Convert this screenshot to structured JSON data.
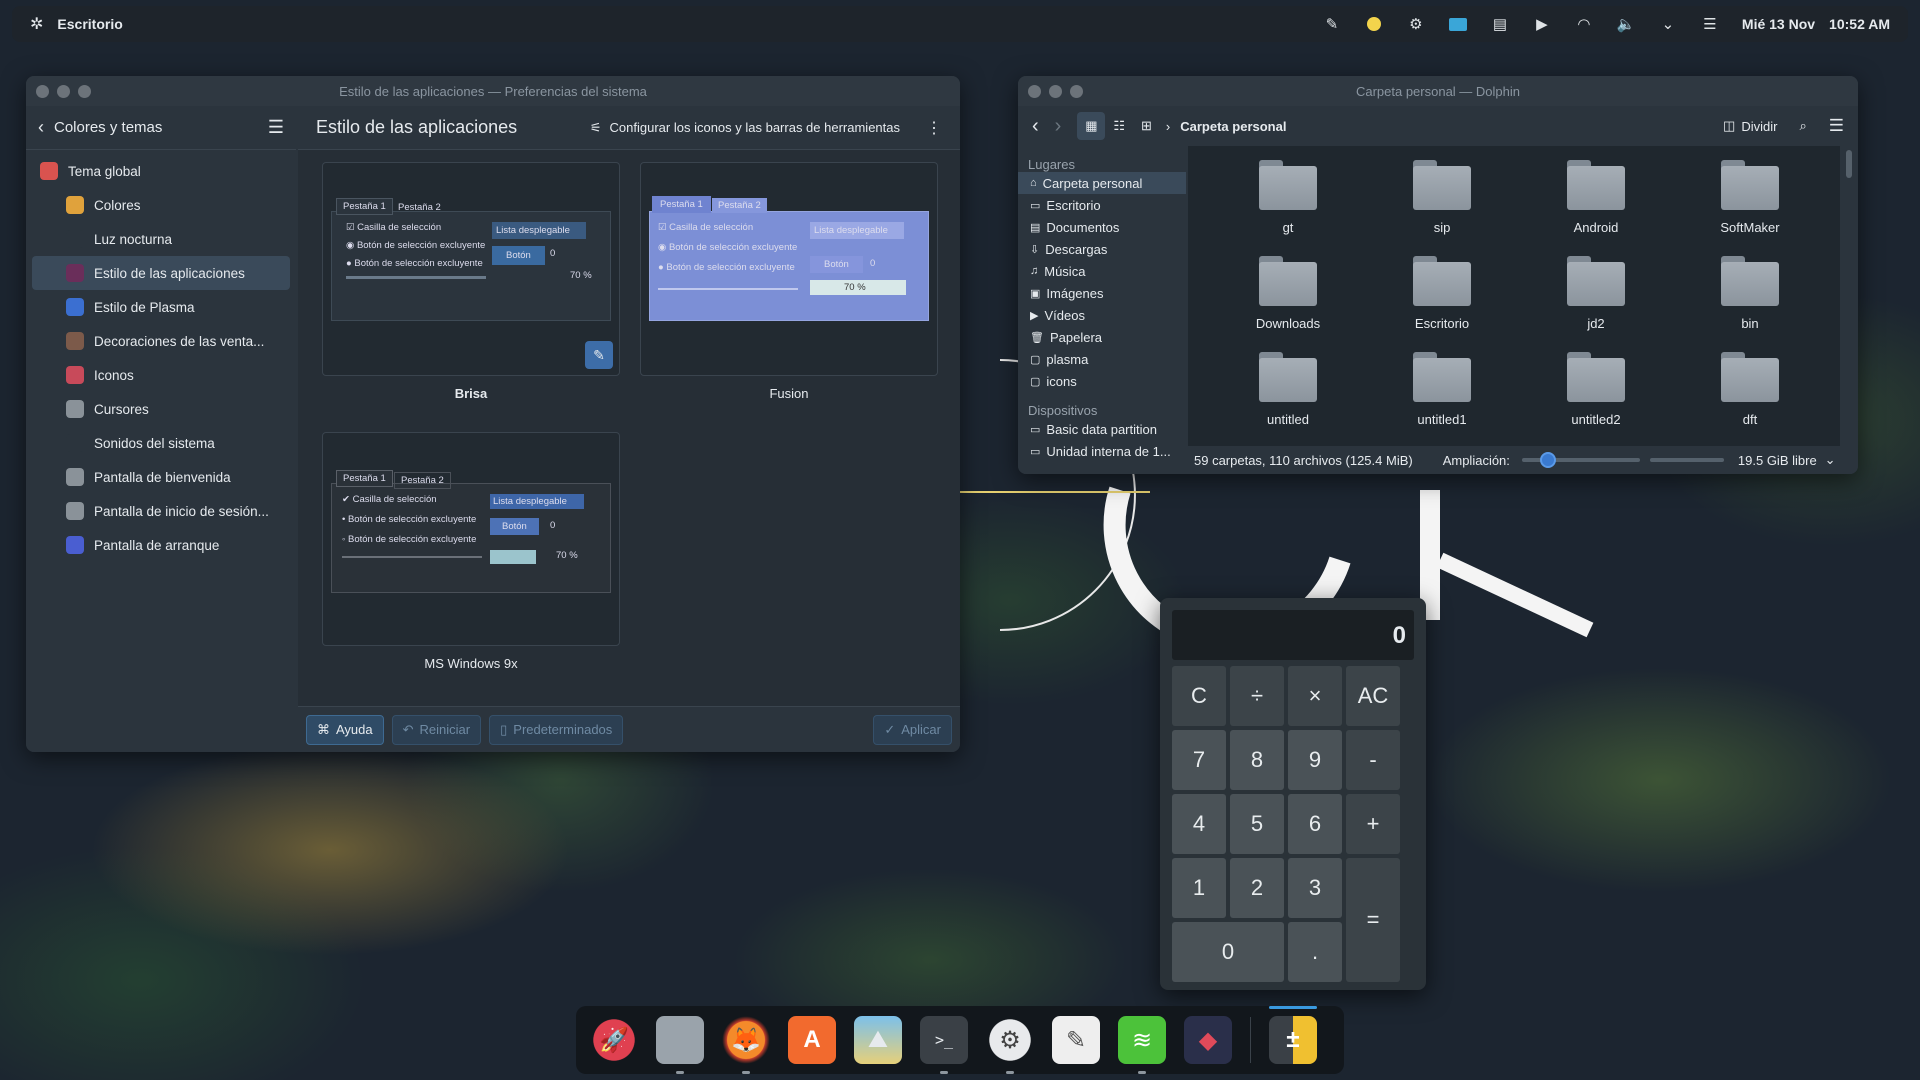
{
  "panel": {
    "launcher": "Escritorio",
    "date": "Mié 13 Nov",
    "time": "10:52 AM"
  },
  "settings": {
    "title": "Estilo de las aplicaciones — Preferencias del sistema",
    "back_label": "Colores y temas",
    "page_title": "Estilo de las aplicaciones",
    "configure_label": "Configurar los iconos y las barras de herramientas",
    "sidebar": [
      {
        "label": "Tema global",
        "color": "#d9534f",
        "top": true
      },
      {
        "label": "Colores",
        "color": "#e0a23c"
      },
      {
        "label": "Luz nocturna",
        "color": "#2b343d"
      },
      {
        "label": "Estilo de las aplicaciones",
        "color": "#6a2e5a",
        "selected": true
      },
      {
        "label": "Estilo de Plasma",
        "color": "#3b6fd1"
      },
      {
        "label": "Decoraciones de las venta...",
        "color": "#7c5a4a"
      },
      {
        "label": "Iconos",
        "color": "#c84a5a"
      },
      {
        "label": "Cursores",
        "color": "#8a9299"
      },
      {
        "label": "Sonidos del sistema",
        "color": "#2b343d"
      },
      {
        "label": "Pantalla de bienvenida",
        "color": "#8a9299"
      },
      {
        "label": "Pantalla de inicio de sesión...",
        "color": "#8a9299"
      },
      {
        "label": "Pantalla de arranque",
        "color": "#4a5ed1"
      }
    ],
    "styles": [
      {
        "name": "Brisa"
      },
      {
        "name": "Fusion"
      },
      {
        "name": "MS Windows 9x"
      }
    ],
    "preview": {
      "tab1": "Pestaña 1",
      "tab2": "Pestaña 2",
      "checkbox": "Casilla de selección",
      "radio": "Botón de selección excluyente",
      "combo": "Lista desplegable",
      "button": "Botón",
      "spin": "0",
      "progress": "70 %"
    },
    "footer": {
      "help": "Ayuda",
      "reset": "Reiniciar",
      "defaults": "Predeterminados",
      "apply": "Aplicar"
    }
  },
  "dolphin": {
    "title": "Carpeta personal — Dolphin",
    "breadcrumb": "Carpeta personal",
    "split": "Dividir",
    "places_header": "Lugares",
    "places": [
      "Carpeta personal",
      "Escritorio",
      "Documentos",
      "Descargas",
      "Música",
      "Imágenes",
      "Vídeos",
      "Papelera",
      "plasma",
      "icons"
    ],
    "devices_header": "Dispositivos",
    "devices": [
      "Basic data partition",
      "Unidad interna de 1..."
    ],
    "folders": [
      "gt",
      "sip",
      "Android",
      "SoftMaker",
      "Downloads",
      "Escritorio",
      "jd2",
      "bin",
      "untitled",
      "untitled1",
      "untitled2",
      "dft"
    ],
    "status": "59 carpetas, 110 archivos (125.4 MiB)",
    "zoom_label": "Ampliación:",
    "zoom_level": 0.22,
    "free": "19.5 GiB libre"
  },
  "calculator": {
    "display": "0",
    "keys": [
      "C",
      "÷",
      "×",
      "AC",
      "7",
      "8",
      "9",
      "-",
      "4",
      "5",
      "6",
      "+",
      "1",
      "2",
      "3",
      "=",
      "0",
      "."
    ]
  },
  "dock": [
    "rocket-launcher",
    "file-manager",
    "firefox",
    "app-store",
    "image-viewer",
    "terminal",
    "system-settings",
    "text-editor",
    "spotify",
    "kdenlive",
    "calculator"
  ]
}
